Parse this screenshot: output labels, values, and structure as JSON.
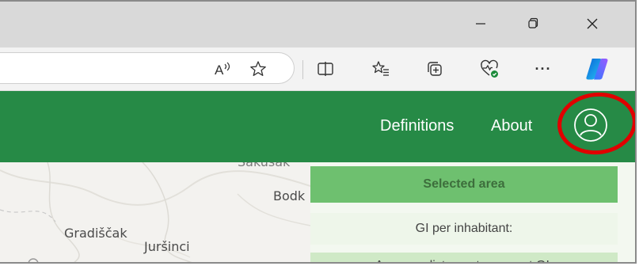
{
  "browser": {
    "toolbar_icons": [
      "read-aloud-icon",
      "favorite-star-icon",
      "split-screen-icon",
      "favorites-list-icon",
      "collections-icon",
      "browser-essentials-icon",
      "more-options-icon",
      "copilot-icon"
    ],
    "more_label": "···"
  },
  "nav": {
    "definitions": "Definitions",
    "about": "About"
  },
  "map": {
    "labels": {
      "sakusak": "Sakušak",
      "bodk": "Bodk",
      "gradiscak": "Gradiščak",
      "jursinci": "Juršinci"
    }
  },
  "panel": {
    "heading": "Selected area",
    "row1": "GI per inhabitant:",
    "row2": "Average distance to nearest GI:"
  },
  "colors": {
    "header_green": "#268a46",
    "panel_heading_green": "#6ec06f",
    "highlight_red": "#e00000"
  }
}
